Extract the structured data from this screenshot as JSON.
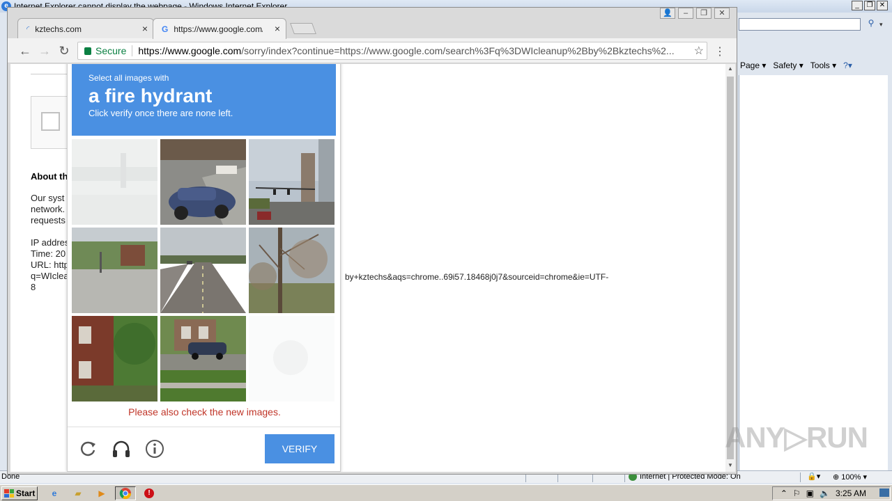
{
  "ie": {
    "title": "Internet Explorer cannot display the webpage - Windows Internet Explorer",
    "menu": [
      "Page ▾",
      "Safety ▾",
      "Tools ▾"
    ],
    "status_left": "Done",
    "status_zone": "Internet | Protected Mode: On",
    "zoom": "100%",
    "search_arrow": "▾"
  },
  "chrome": {
    "tabs": [
      {
        "label": "kztechs.com",
        "close": "×"
      },
      {
        "label": "https://www.google.com/se",
        "close": "×"
      }
    ],
    "secure_label": "Secure",
    "url_host": "https://www.google.com",
    "url_rest": "/sorry/index?continue=https://www.google.com/search%3Fq%3DWIcleanup%2Bby%2Bkztechs%2..."
  },
  "page": {
    "about_heading": "About th",
    "para1": [
      "Our syst",
      "network.",
      "requests"
    ],
    "para2": [
      "IP addres",
      "Time: 20",
      "URL: http",
      "q=WIclea",
      "8"
    ],
    "url_tail": "by+kztechs&aqs=chrome..69i57.18468j0j7&sourceid=chrome&ie=UTF-"
  },
  "captcha": {
    "instruction_top": "Select all images with",
    "target": "a fire hydrant",
    "instruction_bottom": "Click verify once there are none left.",
    "error": "Please also check the new images.",
    "verify_label": "VERIFY",
    "tiles": [
      "tile-faded-intersection",
      "tile-blue-car-street",
      "tile-traffic-lights",
      "tile-parking-lot-trees",
      "tile-highway",
      "tile-bare-tree",
      "tile-brick-house",
      "tile-house-car-lawn",
      "tile-loading-blank"
    ],
    "colors": {
      "header": "#4a90e2",
      "error": "#c03528"
    }
  },
  "taskbar": {
    "start_label": "Start",
    "clock": "3:25 AM"
  },
  "watermark": "ANY▷RUN"
}
